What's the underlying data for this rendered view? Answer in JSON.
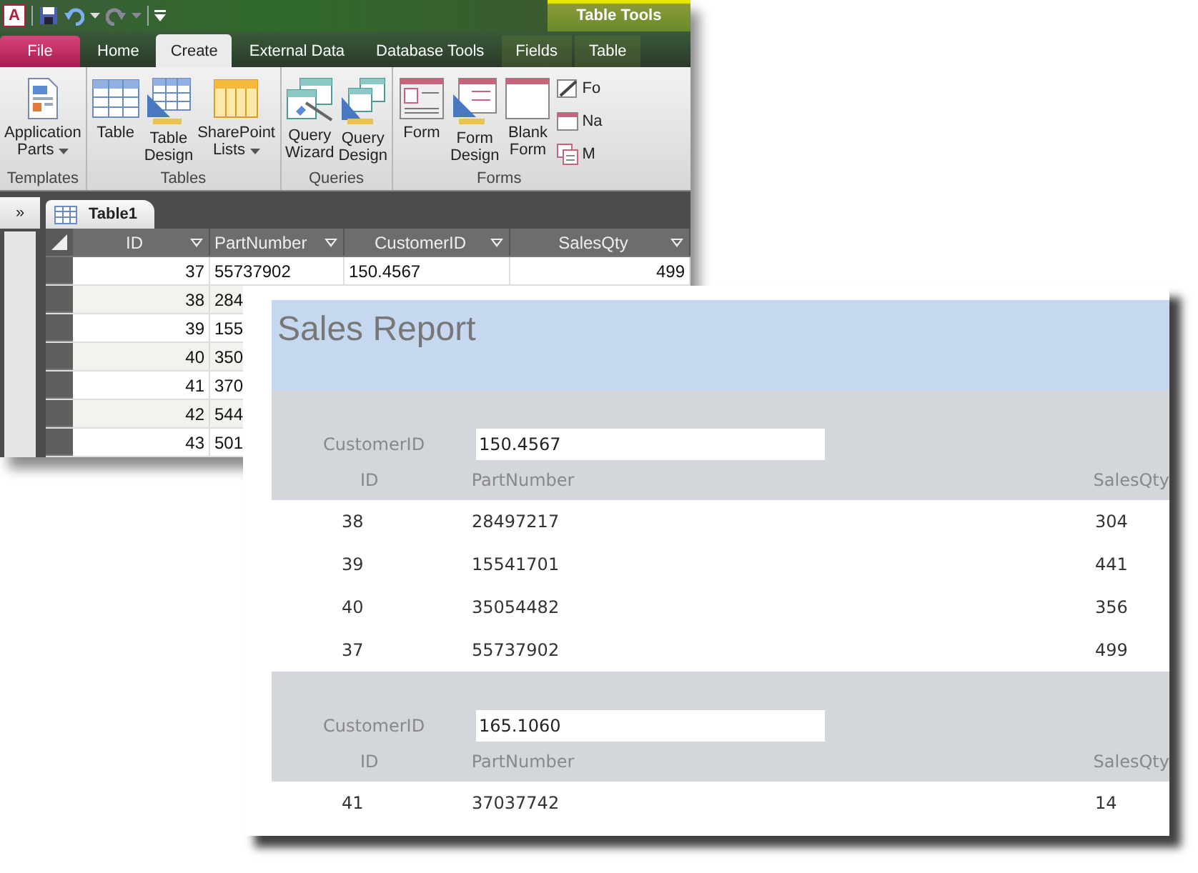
{
  "access_window": {
    "logo": "A",
    "context_tab": "Table Tools",
    "ribbon_tabs": [
      {
        "label": "File",
        "kind": "file",
        "selected": false
      },
      {
        "label": "Home",
        "kind": "normal",
        "selected": false
      },
      {
        "label": "Create",
        "kind": "normal",
        "selected": true
      },
      {
        "label": "External Data",
        "kind": "normal",
        "selected": false
      },
      {
        "label": "Database Tools",
        "kind": "normal",
        "selected": false
      },
      {
        "label": "Fields",
        "kind": "context",
        "selected": false
      },
      {
        "label": "Table",
        "kind": "context",
        "selected": false
      }
    ],
    "ribbon_groups": [
      {
        "label": "Templates",
        "buttons": [
          {
            "label": "Application Parts",
            "kind": "large",
            "dropdown": true
          }
        ]
      },
      {
        "label": "Tables",
        "buttons": [
          {
            "label": "Table",
            "kind": "large",
            "dropdown": false
          },
          {
            "label": "Table Design",
            "kind": "large",
            "dropdown": false
          },
          {
            "label": "SharePoint Lists",
            "kind": "large",
            "dropdown": true
          }
        ]
      },
      {
        "label": "Queries",
        "buttons": [
          {
            "label": "Query Wizard",
            "kind": "large",
            "dropdown": false
          },
          {
            "label": "Query Design",
            "kind": "large",
            "dropdown": false
          }
        ]
      },
      {
        "label": "Forms",
        "buttons": [
          {
            "label": "Form",
            "kind": "large",
            "dropdown": false
          },
          {
            "label": "Form Design",
            "kind": "large",
            "dropdown": false
          },
          {
            "label": "Blank Form",
            "kind": "large",
            "dropdown": false
          },
          {
            "label": "Fo",
            "kind": "small"
          },
          {
            "label": "Na",
            "kind": "small"
          },
          {
            "label": "M",
            "kind": "small"
          }
        ]
      }
    ],
    "nav_toggle": "»",
    "document_tab": "Table1",
    "table": {
      "columns": [
        "ID",
        "PartNumber",
        "CustomerID",
        "SalesQty"
      ],
      "rows": [
        [
          "37",
          "55737902",
          "150.4567",
          "499"
        ],
        [
          "38",
          "284"
        ],
        [
          "39",
          "155"
        ],
        [
          "40",
          "350"
        ],
        [
          "41",
          "370"
        ],
        [
          "42",
          "544"
        ],
        [
          "43",
          "501"
        ]
      ]
    }
  },
  "report": {
    "title": "Sales Report",
    "groups": [
      {
        "label": "CustomerID",
        "value": "150.4567",
        "columns": [
          "ID",
          "PartNumber",
          "SalesQty"
        ],
        "rows": [
          [
            "38",
            "28497217",
            "304"
          ],
          [
            "39",
            "15541701",
            "441"
          ],
          [
            "40",
            "35054482",
            "356"
          ],
          [
            "37",
            "55737902",
            "499"
          ]
        ]
      },
      {
        "label": "CustomerID",
        "value": "165.1060",
        "columns": [
          "ID",
          "PartNumber",
          "SalesQty"
        ],
        "rows": [
          [
            "41",
            "37037742",
            "14"
          ]
        ]
      }
    ]
  }
}
